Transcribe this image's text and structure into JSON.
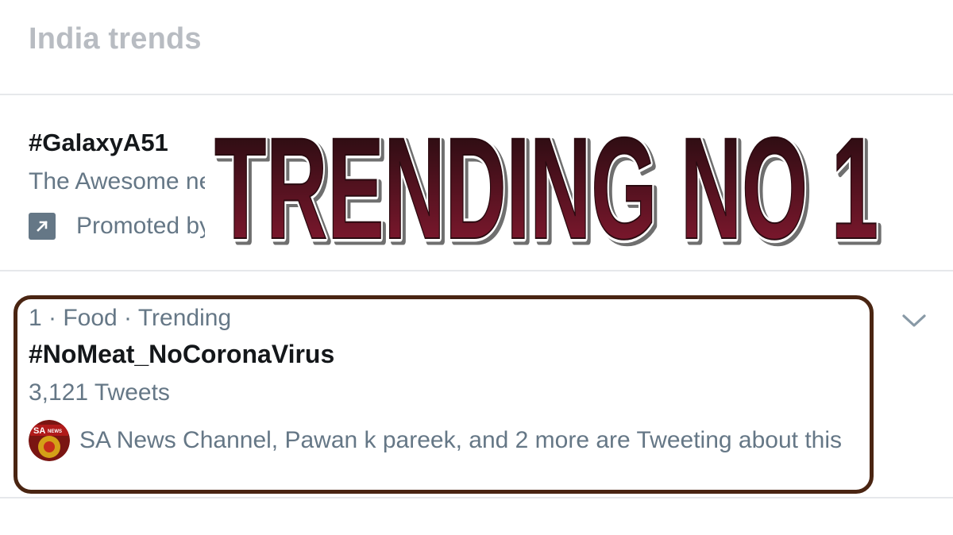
{
  "header": {
    "title": "India trends"
  },
  "promoted_trend": {
    "hashtag": "#GalaxyA51",
    "description": "The Awesome ne",
    "promoted_label": "Promoted by",
    "icon": "promoted-arrow-icon"
  },
  "overlay": {
    "text": "TRENDING NO 1",
    "color_top": "#1a0a0c",
    "color_bottom": "#8e1a33"
  },
  "trend": {
    "meta": "1 · Food · Trending",
    "hashtag": "#NoMeat_NoCoronaVirus",
    "tweet_count": "3,121 Tweets",
    "tweeting_text": "SA News Channel, Pawan k pareek, and 2 more are Tweeting about this",
    "avatar_badge": "SA",
    "avatar_badge_small": "NEWS"
  },
  "colors": {
    "highlight_border": "#4a2512",
    "secondary_text": "#657786",
    "primary_text": "#14171a",
    "header_text": "#b8bcc2"
  }
}
